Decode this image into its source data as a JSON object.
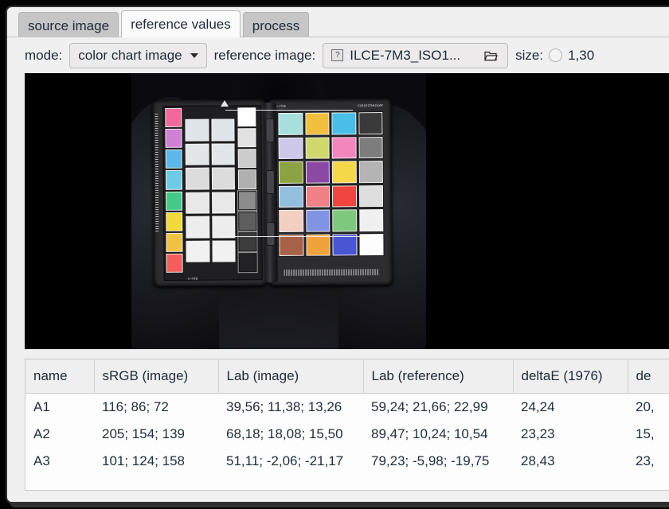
{
  "window": {
    "tabs": [
      {
        "label": "source image",
        "active": false
      },
      {
        "label": "reference values",
        "active": true
      },
      {
        "label": "process",
        "active": false
      }
    ]
  },
  "toolbar": {
    "mode_label": "mode:",
    "mode_value": "color chart image",
    "reference_image_label": "reference image:",
    "reference_image_value": "ILCE-7M3_ISO1...",
    "reference_image_placeholder_glyph": "?",
    "browse_icon": "folder-open-icon",
    "size_label": "size:",
    "size_value": "1,30"
  },
  "viewer": {
    "content": "photo of X-Rite ColorChecker Passport on dark fabric",
    "left_chart_brand": "x-rite",
    "right_chart_brand": "x-rite",
    "right_chart_name": "colorchecker",
    "classic_patches": [
      [
        "#a8dfdc",
        "#f0bf3e",
        "#49bfe8",
        "#3a3a3a"
      ],
      [
        "#cdc8ea",
        "#cfd96b",
        "#f386bd",
        "#7d7d7d"
      ],
      [
        "#8da343",
        "#8b49a4",
        "#f4d848",
        "#b4b4b4"
      ],
      [
        "#94bede",
        "#f08187",
        "#f1453f",
        "#dedede"
      ],
      [
        "#f2cfc1",
        "#8194e4",
        "#7ec87e",
        "#f0f0f0"
      ],
      [
        "#a8624a",
        "#f0a23c",
        "#4a55d1",
        "#fdfdfd"
      ]
    ],
    "enhancement_colors": [
      "#f2699b",
      "#cf7fd4",
      "#5cb8ea",
      "#6fcbe4",
      "#43c98a",
      "#f2d93c",
      "#efc243",
      "#f05f5c"
    ],
    "selection_visible": true
  },
  "table": {
    "columns": [
      "name",
      "sRGB (image)",
      "Lab (image)",
      "Lab (reference)",
      "deltaE (1976)",
      "de"
    ],
    "rows": [
      {
        "name": "A1",
        "srgb_image": "116; 86; 72",
        "lab_image": "39,56; 11,38; 13,26",
        "lab_reference": "59,24; 21,66; 22,99",
        "delta_e_1976": "24,24",
        "delta_e_next": "20,"
      },
      {
        "name": "A2",
        "srgb_image": "205; 154; 139",
        "lab_image": "68,18; 18,08; 15,50",
        "lab_reference": "89,47; 10,24; 10,54",
        "delta_e_1976": "23,23",
        "delta_e_next": "15,"
      },
      {
        "name": "A3",
        "srgb_image": "101; 124; 158",
        "lab_image": "51,11; -2,06; -21,17",
        "lab_reference": "79,23; -5,98; -19,75",
        "delta_e_1976": "28,43",
        "delta_e_next": "23,"
      }
    ]
  }
}
